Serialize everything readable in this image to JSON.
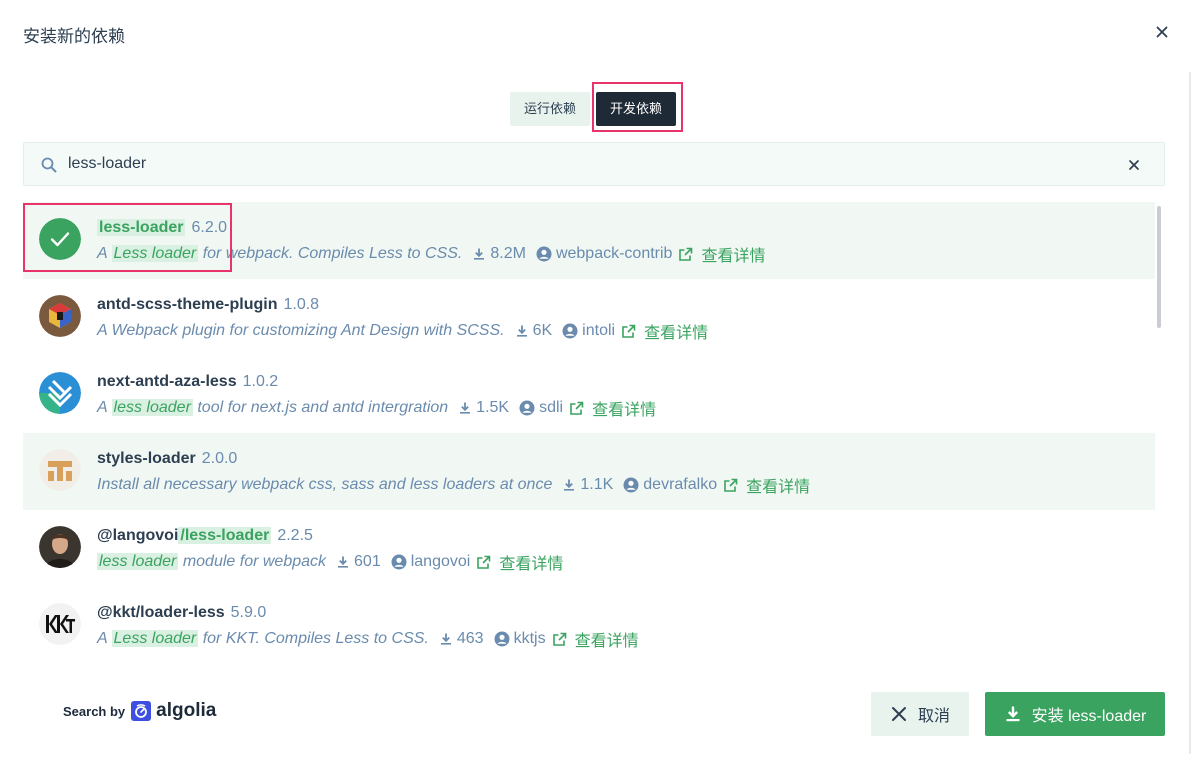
{
  "dialog": {
    "title": "安装新的依赖"
  },
  "tabs": [
    {
      "label": "运行依赖",
      "active": false
    },
    {
      "label": "开发依赖",
      "active": true
    }
  ],
  "search": {
    "value": "less-loader",
    "icon": "search-icon",
    "clear_icon": "close-icon"
  },
  "results": [
    {
      "name_prefix": "",
      "name_match": "less-loader",
      "name_rest": "",
      "version": "6.2.0",
      "desc_pre": "A ",
      "desc_match": "Less loader",
      "desc_post": " for webpack. Compiles Less to CSS.",
      "downloads": "8.2M",
      "author": "webpack-contrib",
      "link": "查看详情",
      "selected": true
    },
    {
      "name_prefix": "antd-scss-theme-plugin",
      "name_match": "",
      "name_rest": "",
      "version": "1.0.8",
      "desc_pre": "A Webpack plugin for customizing Ant Design with SCSS.",
      "desc_match": "",
      "desc_post": "",
      "downloads": "6K",
      "author": "intoli",
      "link": "查看详情",
      "selected": false
    },
    {
      "name_prefix": "next-antd-aza-less",
      "name_match": "",
      "name_rest": "",
      "version": "1.0.2",
      "desc_pre": "A ",
      "desc_match": "less loader",
      "desc_post": " tool for next.js and antd intergration",
      "downloads": "1.5K",
      "author": "sdli",
      "link": "查看详情",
      "selected": false
    },
    {
      "name_prefix": "styles-loader",
      "name_match": "",
      "name_rest": "",
      "version": "2.0.0",
      "desc_pre": "Install all necessary webpack css, sass and less loaders at once",
      "desc_match": "",
      "desc_post": "",
      "downloads": "1.1K",
      "author": "devrafalko",
      "link": "查看详情",
      "selected": false
    },
    {
      "name_prefix": "@langovoi",
      "name_match": "/less-loader",
      "name_rest": "",
      "version": "2.2.5",
      "desc_pre": "",
      "desc_match": "less loader",
      "desc_post": " module for webpack",
      "downloads": "601",
      "author": "langovoi",
      "link": "查看详情",
      "selected": false
    },
    {
      "name_prefix": "@kkt/loader-less",
      "name_match": "",
      "name_rest": "",
      "version": "5.9.0",
      "desc_pre": "A ",
      "desc_match": "Less loader",
      "desc_post": " for KKT. Compiles Less to CSS.",
      "downloads": "463",
      "author": "kktjs",
      "link": "查看详情",
      "selected": false
    }
  ],
  "footer": {
    "search_by": "Search by",
    "brand": "algolia",
    "cancel_label": "取消",
    "install_label": "安装 less-loader"
  },
  "colors": {
    "accent": "#3aa35f",
    "highlight_box": "#e8336b",
    "active_tab": "#1f2a37"
  }
}
